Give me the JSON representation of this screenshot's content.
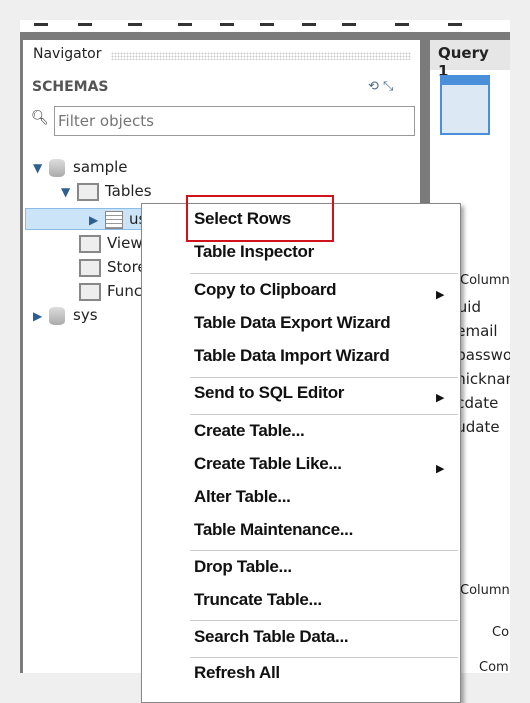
{
  "navigator": {
    "title": "Navigator",
    "schemas_label": "SCHEMAS",
    "filter_placeholder": "Filter objects",
    "tree": {
      "sample": "sample",
      "tables": "Tables",
      "user": "user",
      "views": "Views",
      "stored": "Stored Procedures",
      "functions": "Functions",
      "sys": "sys"
    }
  },
  "query_tab": "Query 1",
  "columns": {
    "header": "Column",
    "items": [
      "uid",
      "email",
      "password",
      "nickname",
      "cdate",
      "udate"
    ],
    "footer_header": "Column",
    "co": "Co",
    "com": "Com"
  },
  "context_menu": {
    "items": [
      {
        "label": "Select Rows",
        "highlighted": true
      },
      {
        "label": "Table Inspector"
      },
      {
        "label": "Copy to Clipboard",
        "submenu": true
      },
      {
        "label": "Table Data Export Wizard"
      },
      {
        "label": "Table Data Import Wizard"
      },
      {
        "label": "Send to SQL Editor",
        "submenu": true
      },
      {
        "label": "Create Table..."
      },
      {
        "label": "Create Table Like...",
        "submenu": true
      },
      {
        "label": "Alter Table..."
      },
      {
        "label": "Table Maintenance..."
      },
      {
        "label": "Drop Table..."
      },
      {
        "label": "Truncate Table..."
      },
      {
        "label": "Search Table Data..."
      },
      {
        "label": "Refresh All"
      }
    ]
  },
  "colors": {
    "highlight_box": "#d0121b",
    "selection": "#cce4f7"
  }
}
